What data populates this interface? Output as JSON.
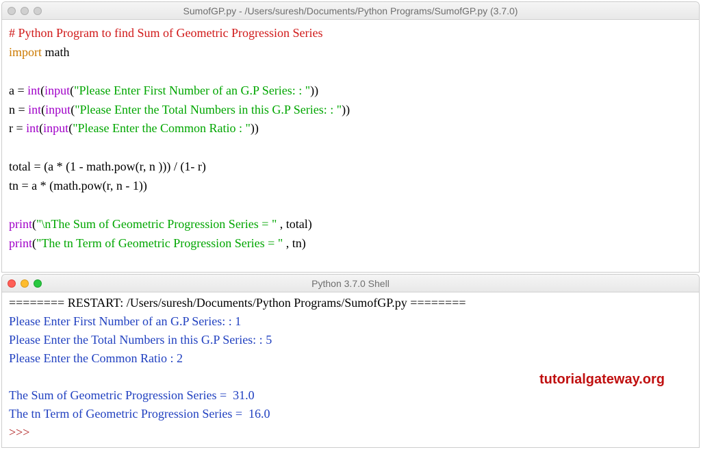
{
  "editor": {
    "title": "SumofGP.py - /Users/suresh/Documents/Python Programs/SumofGP.py (3.7.0)",
    "lines": {
      "comment": "# Python Program to find Sum of Geometric Progression Series",
      "import_kw": "import",
      "import_name": " math",
      "a_lhs": "a = ",
      "n_lhs": "n = ",
      "r_lhs": "r = ",
      "int_fn": "int",
      "input_fn": "input",
      "open": "(",
      "close": ")",
      "close2": "))",
      "a_str": "\"Please Enter First Number of an G.P Series: : \"",
      "n_str": "\"Please Enter the Total Numbers in this G.P Series: : \"",
      "r_str": "\"Please Enter the Common Ratio : \"",
      "total_line": "total = (a * (1 - math.pow(r, n ))) / (1- r)",
      "tn_line": "tn = a * (math.pow(r, n - 1))",
      "print_fn": "print",
      "p1_str": "\"\\nThe Sum of Geometric Progression Series = \"",
      "p1_tail": " , total)",
      "p2_str": "\"The tn Term of Geometric Progression Series = \"",
      "p2_tail": " , tn)"
    }
  },
  "shell": {
    "title": "Python 3.7.0 Shell",
    "restart_line": "======== RESTART: /Users/suresh/Documents/Python Programs/SumofGP.py ========",
    "in1": "Please Enter First Number of an G.P Series: : 1",
    "in2": "Please Enter the Total Numbers in this G.P Series: : 5",
    "in3": "Please Enter the Common Ratio : 2",
    "out1": "The Sum of Geometric Progression Series =  31.0",
    "out2": "The tn Term of Geometric Progression Series =  16.0",
    "prompt": ">>> "
  },
  "watermark": "tutorialgateway.org"
}
